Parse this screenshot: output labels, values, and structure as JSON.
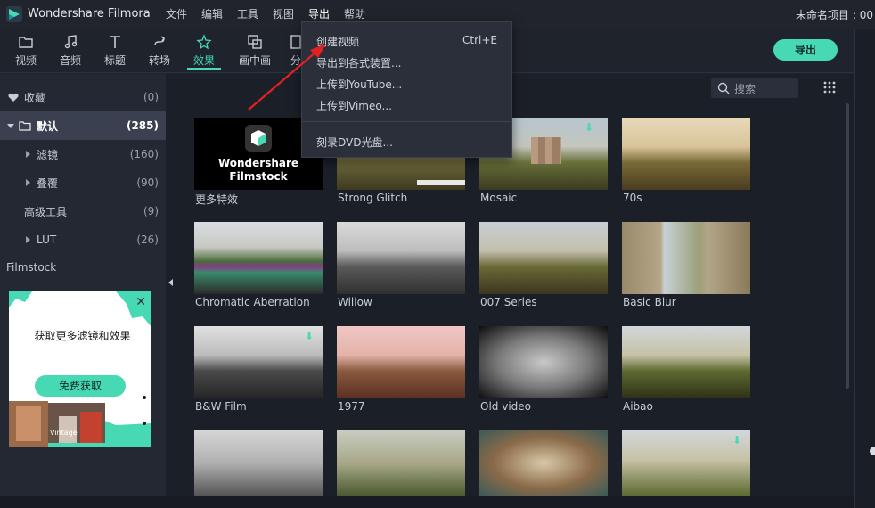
{
  "window": {
    "app_title": "Wondershare Filmora",
    "project_title": "未命名项目 : 00"
  },
  "menu": [
    "文件",
    "编辑",
    "工具",
    "视图",
    "导出",
    "帮助"
  ],
  "toolbar": {
    "tabs": [
      {
        "label": "视频",
        "icon": "folder-icon"
      },
      {
        "label": "音频",
        "icon": "music-note-icon"
      },
      {
        "label": "标题",
        "icon": "text-t-icon"
      },
      {
        "label": "转场",
        "icon": "transition-icon"
      },
      {
        "label": "效果",
        "icon": "effects-star-icon"
      },
      {
        "label": "画中画",
        "icon": "pip-icon"
      },
      {
        "label": "分",
        "icon": "split-icon"
      }
    ],
    "active_tab": "效果",
    "export_label": "导出"
  },
  "sidebar": {
    "items": [
      {
        "label": "收藏",
        "count": "(0)",
        "icon": "heart-icon"
      },
      {
        "label": "默认",
        "count": "(285)",
        "icon": "folder-icon"
      },
      {
        "label": "滤镜",
        "count": "(160)"
      },
      {
        "label": "叠覆",
        "count": "(90)"
      },
      {
        "label": "高级工具",
        "count": "(9)"
      },
      {
        "label": "LUT",
        "count": "(26)"
      }
    ],
    "filmstock_title": "Filmstock"
  },
  "ad": {
    "title": "获取更多滤镜和效果",
    "button": "免费获取",
    "badge_text": "Vintage"
  },
  "search": {
    "placeholder": "搜索"
  },
  "effects": [
    {
      "label": "更多特效",
      "thumb_text": "Wondershare Filmstock"
    },
    {
      "label": "Strong Glitch"
    },
    {
      "label": "Mosaic"
    },
    {
      "label": "70s"
    },
    {
      "label": "Chromatic Aberration"
    },
    {
      "label": "Willow"
    },
    {
      "label": "007 Series"
    },
    {
      "label": "Basic Blur"
    },
    {
      "label": "B&W Film"
    },
    {
      "label": "1977"
    },
    {
      "label": "Old video"
    },
    {
      "label": "Aibao"
    },
    {
      "label": ""
    },
    {
      "label": ""
    },
    {
      "label": ""
    },
    {
      "label": ""
    }
  ],
  "export_menu": [
    {
      "label": "创建视频",
      "shortcut": "Ctrl+E"
    },
    {
      "label": "导出到各式装置...",
      "shortcut": ""
    },
    {
      "label": "上传到YouTube...",
      "shortcut": ""
    },
    {
      "label": "上传到Vimeo...",
      "shortcut": ""
    },
    {
      "label": "刻录DVD光盘...",
      "shortcut": ""
    }
  ],
  "colors": {
    "accent": "#46d9b4",
    "annotation_arrow": "#e32121"
  }
}
